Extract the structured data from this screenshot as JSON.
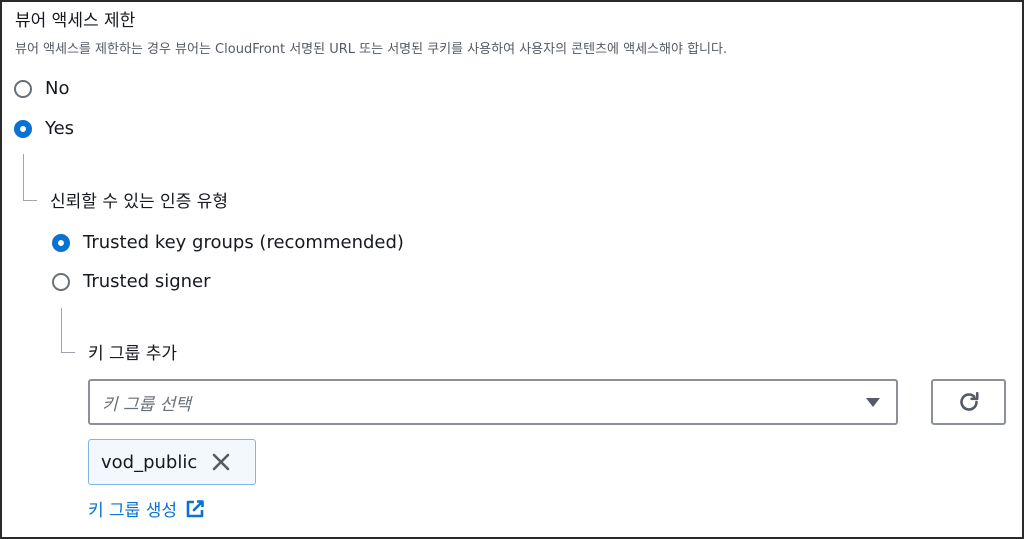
{
  "section": {
    "title": "뷰어 액세스 제한",
    "description": "뷰어 액세스를 제한하는 경우 뷰어는 CloudFront 서명된 URL 또는 서명된 쿠키를 사용하여 사용자의 콘텐츠에 액세스해야 합니다."
  },
  "restrict_options": [
    {
      "label": "No",
      "selected": false
    },
    {
      "label": "Yes",
      "selected": true
    }
  ],
  "trusted_auth": {
    "label": "신뢰할 수 있는 인증 유형",
    "options": [
      {
        "label": "Trusted key groups (recommended)",
        "selected": true
      },
      {
        "label": "Trusted signer",
        "selected": false
      }
    ]
  },
  "key_groups": {
    "label": "키 그룹 추가",
    "select_placeholder": "키 그룹 선택",
    "selected_tokens": [
      "vod_public"
    ],
    "create_link": "키 그룹 생성"
  },
  "colors": {
    "accent": "#0972d3",
    "text": "#16191f",
    "muted": "#545b64"
  }
}
